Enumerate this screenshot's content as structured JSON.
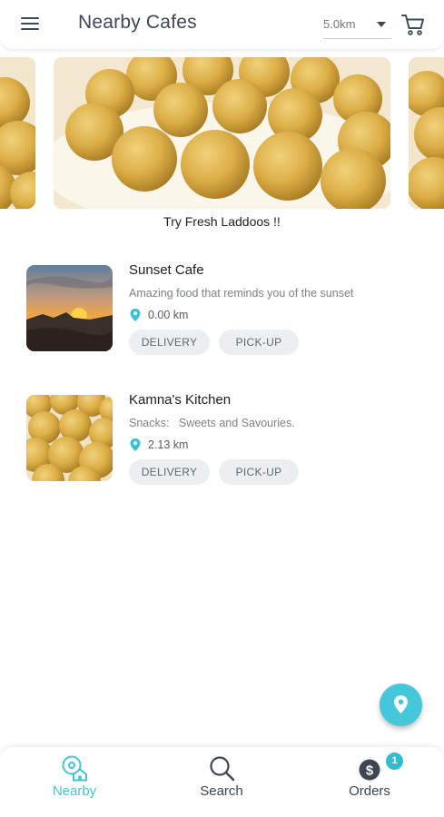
{
  "app_bar": {
    "title": "Nearby Cafes",
    "distance_filter": "5.0km",
    "icons": [
      "menu-icon",
      "chevron-down-icon",
      "cart-icon"
    ]
  },
  "carousel": {
    "caption": "Try Fresh Laddoos !!"
  },
  "cafes": [
    {
      "name": "Sunset Cafe",
      "description": "Amazing food that reminds you of the sunset",
      "distance": "0.00 km",
      "options": [
        "DELIVERY",
        "PICK-UP"
      ]
    },
    {
      "name": "Kamna's Kitchen",
      "description": "Snacks:   Sweets and Savouries.",
      "distance": "2.13 km",
      "options": [
        "DELIVERY",
        "PICK-UP"
      ]
    }
  ],
  "bottom_nav": {
    "items": [
      {
        "label": "Nearby",
        "icon": "nearby-home-pin-icon",
        "active": true
      },
      {
        "label": "Search",
        "icon": "search-icon",
        "active": false
      },
      {
        "label": "Orders",
        "icon": "dollar-coin-icon",
        "active": false,
        "badge": "1"
      }
    ]
  },
  "colors": {
    "accent": "#45c3d6",
    "title_text": "#3b4656",
    "chip_bg": "#eceff1",
    "badge": "#2fbcd1"
  }
}
